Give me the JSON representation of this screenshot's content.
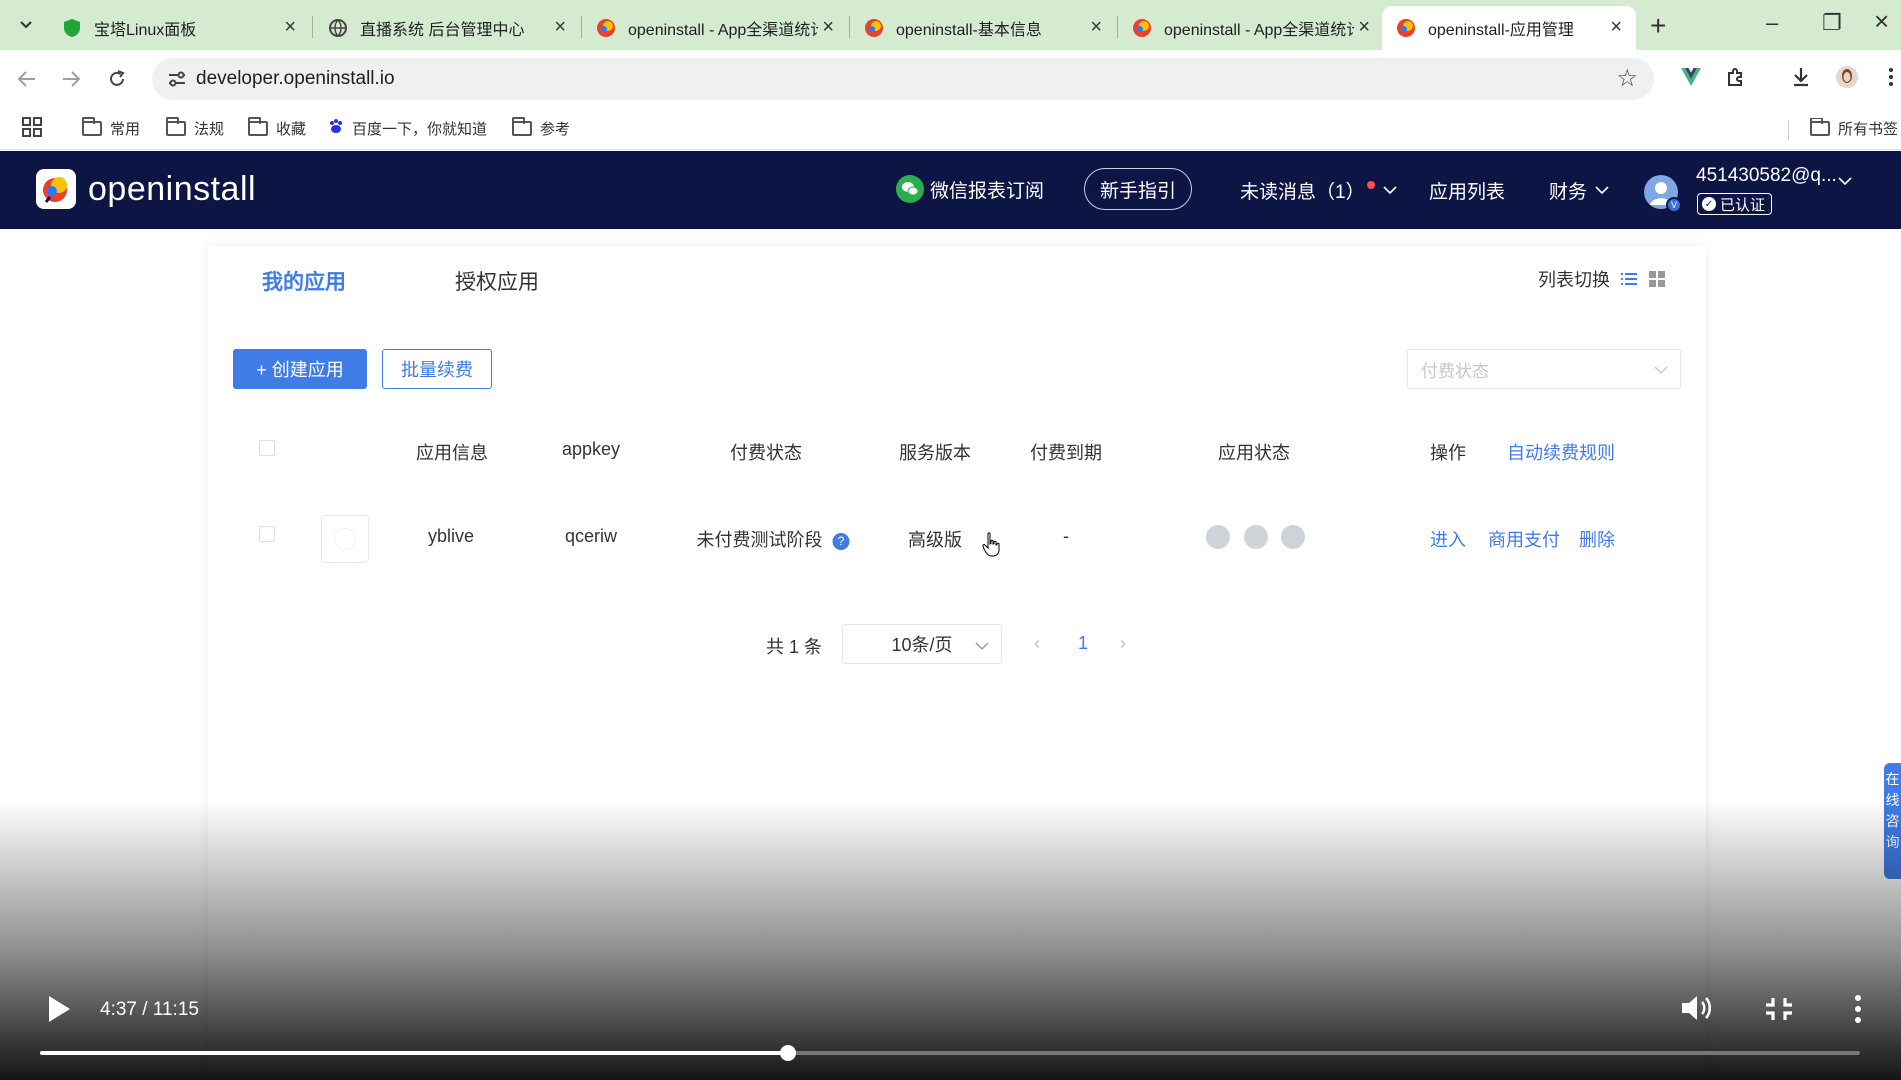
{
  "browser": {
    "tabs": [
      {
        "title": "宝塔Linux面板",
        "favicon": "shield-icon",
        "color": "#20a53a"
      },
      {
        "title": "直播系统 后台管理中心",
        "favicon": "globe-icon",
        "color": "#444444"
      },
      {
        "title": "openinstall - App全渠道统计",
        "favicon": "openinstall-icon",
        "color": "#e8412c"
      },
      {
        "title": "openinstall-基本信息",
        "favicon": "openinstall-icon",
        "color": "#e8412c"
      },
      {
        "title": "openinstall - App全渠道统计",
        "favicon": "openinstall-icon",
        "color": "#e8412c"
      },
      {
        "title": "openinstall-应用管理",
        "favicon": "openinstall-icon",
        "color": "#e8412c",
        "active": true
      }
    ],
    "url": "developer.openinstall.io",
    "bookmarks": [
      {
        "label": "常用",
        "icon": "folder-icon"
      },
      {
        "label": "法规",
        "icon": "folder-icon"
      },
      {
        "label": "收藏",
        "icon": "folder-icon"
      },
      {
        "label": "百度一下，你就知道",
        "icon": "baidu-icon"
      },
      {
        "label": "参考",
        "icon": "folder-icon"
      }
    ],
    "all_bookmarks": "所有书签"
  },
  "header": {
    "logo": "openinstall",
    "wechat_report": "微信报表订阅",
    "guide": "新手指引",
    "unread": "未读消息（1）",
    "app_list": "应用列表",
    "finance": "财务",
    "user_email": "451430582@q...",
    "verified": "已认证"
  },
  "main": {
    "tabs": [
      "我的应用",
      "授权应用"
    ],
    "view_switch": "列表切换",
    "create_btn": "+ 创建应用",
    "batch_renew": "批量续费",
    "pay_status_placeholder": "付费状态",
    "table": {
      "headers": [
        "应用信息",
        "appkey",
        "付费状态",
        "服务版本",
        "付费到期",
        "应用状态",
        "操作"
      ],
      "auto_renew_rule": "自动续费规则",
      "rows": [
        {
          "name": "yblive",
          "appkey": "qceriw",
          "pay_status": "未付费测试阶段",
          "version": "高级版",
          "expiry": "-",
          "platforms": [
            "android-icon",
            "apple-icon",
            "huawei-icon"
          ],
          "actions": [
            "进入",
            "商用支付",
            "删除"
          ]
        }
      ]
    },
    "pager": {
      "total": "共 1 条",
      "page_size": "10条/页",
      "page": "1"
    },
    "side_help": "在线咨询"
  },
  "video": {
    "time": "4:37 / 11:15",
    "progress": 0.411
  },
  "colors": {
    "accent": "#3f7ce5",
    "header_bg": "#0d1545",
    "tabstrip_bg": "#d5ebd0"
  }
}
